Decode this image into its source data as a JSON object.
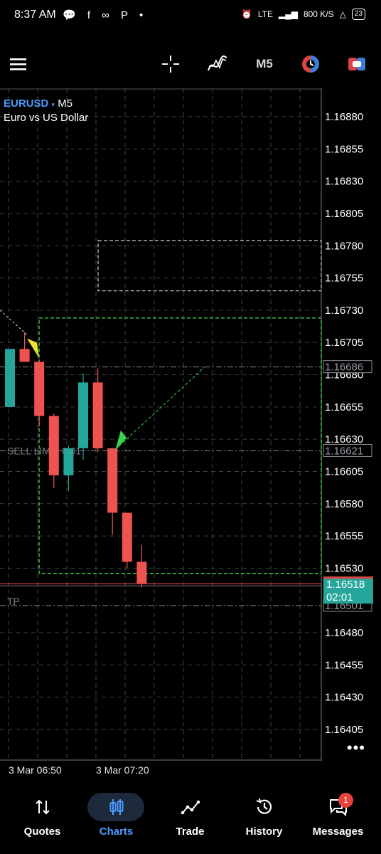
{
  "status_bar": {
    "time": "8:37 AM",
    "left_icons": "💬 f ∞ P •",
    "network": "LTE",
    "speed": "800 K/S",
    "battery": "23"
  },
  "toolbar": {
    "timeframe": "M5"
  },
  "symbol": {
    "name": "EURUSD",
    "arrow": "▾",
    "timeframe": "M5",
    "description": "Euro vs US Dollar"
  },
  "chart_data": {
    "type": "candlestick",
    "symbol": "EURUSD",
    "timeframe": "M5",
    "ylim": [
      1.16388,
      1.16893
    ],
    "y_ticks": [
      "1.16880",
      "1.16855",
      "1.16830",
      "1.16805",
      "1.16780",
      "1.16755",
      "1.16730",
      "1.16705",
      "1.16680",
      "1.16655",
      "1.16630",
      "1.16605",
      "1.16580",
      "1.16555",
      "1.16530",
      "1.16480",
      "1.16455",
      "1.16430",
      "1.16405"
    ],
    "x_labels": [
      "3 Mar 06:50",
      "3 Mar 07:20"
    ],
    "candles": [
      {
        "open": 1.16655,
        "high": 1.167,
        "low": 1.16655,
        "close": 1.167,
        "dir": "up"
      },
      {
        "open": 1.167,
        "high": 1.16713,
        "low": 1.1669,
        "close": 1.1669,
        "dir": "down"
      },
      {
        "open": 1.1669,
        "high": 1.16692,
        "low": 1.1664,
        "close": 1.16648,
        "dir": "down"
      },
      {
        "open": 1.16648,
        "high": 1.1665,
        "low": 1.16592,
        "close": 1.16602,
        "dir": "down"
      },
      {
        "open": 1.16602,
        "high": 1.16625,
        "low": 1.1659,
        "close": 1.16623,
        "dir": "up"
      },
      {
        "open": 1.16623,
        "high": 1.16681,
        "low": 1.16614,
        "close": 1.16674,
        "dir": "up"
      },
      {
        "open": 1.16674,
        "high": 1.16685,
        "low": 1.1662,
        "close": 1.16623,
        "dir": "down"
      },
      {
        "open": 1.16623,
        "high": 1.16623,
        "low": 1.16556,
        "close": 1.16573,
        "dir": "down"
      },
      {
        "open": 1.16573,
        "high": 1.16573,
        "low": 1.1653,
        "close": 1.16535,
        "dir": "down"
      },
      {
        "open": 1.16535,
        "high": 1.16548,
        "low": 1.16515,
        "close": 1.16518,
        "dir": "down"
      }
    ],
    "levels": [
      {
        "name": "entry",
        "price": 1.16686,
        "label": "1.16686"
      },
      {
        "name": "sell_limit",
        "price": 1.16621,
        "label": "1.16621",
        "text": "SELL LIMIT 0.01"
      },
      {
        "name": "tp",
        "price": 1.16501,
        "label": "1.16501",
        "text": "TP"
      }
    ],
    "current_price": {
      "price": 1.16518,
      "label": "1.16518",
      "countdown": "02:01"
    },
    "zones": [
      {
        "name": "white-zone",
        "top": 1.16784,
        "bottom": 1.16745
      },
      {
        "name": "green-zone",
        "top": 1.16724,
        "bottom": 1.16526
      }
    ],
    "colors": {
      "up": "#26a69a",
      "down": "#ef5350",
      "grid": "#3a3f4a",
      "green_zone": "#3bd34a",
      "current": "#e04343"
    }
  },
  "nav": {
    "items": [
      {
        "label": "Quotes",
        "icon": "sort-arrows-icon"
      },
      {
        "label": "Charts",
        "icon": "candles-icon"
      },
      {
        "label": "Trade",
        "icon": "trade-line-icon"
      },
      {
        "label": "History",
        "icon": "history-icon"
      },
      {
        "label": "Messages",
        "icon": "messages-icon"
      }
    ],
    "badge": "1"
  }
}
